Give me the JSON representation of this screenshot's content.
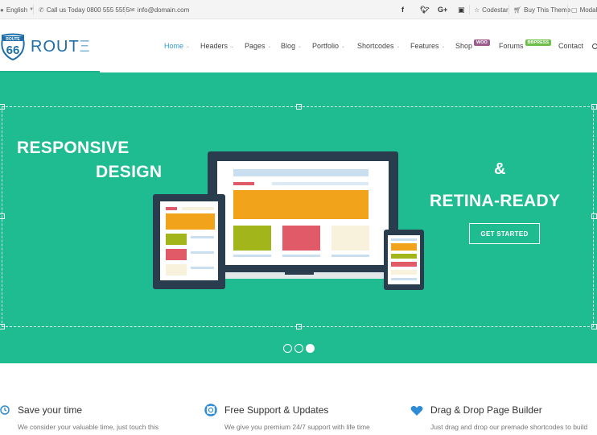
{
  "topbar": {
    "language": "English",
    "phone": "Call us Today 0800 555 5555",
    "email": "info@domain.com",
    "social": [
      "f",
      "t",
      "G+",
      "ig"
    ],
    "links": [
      "Codestar",
      "Buy This Theme",
      "Modal"
    ]
  },
  "header": {
    "logo_badge_top": "ROUTE",
    "logo_badge_num": "66",
    "logo_text": "ROUT",
    "logo_text_dim": "Ξ",
    "nav": [
      {
        "label": "Home",
        "active": true,
        "caret": true
      },
      {
        "label": "Headers",
        "caret": true
      },
      {
        "label": "Pages",
        "caret": true
      },
      {
        "label": "Blog",
        "caret": true
      },
      {
        "label": "Portfolio",
        "caret": true
      },
      {
        "label": "Shortcodes",
        "caret": true
      },
      {
        "label": "Features",
        "caret": true
      },
      {
        "label": "Shop",
        "badge": "WOO",
        "badge_color": "#9b5c8f"
      },
      {
        "label": "Forums",
        "badge": "BBPRESS",
        "badge_color": "#6fbf4b"
      },
      {
        "label": "Contact"
      }
    ]
  },
  "slider": {
    "line1": "RESPONSIVE",
    "line2": "DESIGN",
    "amp": "&",
    "line3": "RETINA-READY",
    "cta": "GET STARTED",
    "dots": 3,
    "active_dot": 3
  },
  "features": [
    {
      "icon": "clock-icon",
      "title": "Save your time",
      "text": "We consider your valuable time, just touch this"
    },
    {
      "icon": "lifebuoy-icon",
      "title": "Free Support & Updates",
      "text": "We give you premium 24/7 support with life time"
    },
    {
      "icon": "heart-icon",
      "title": "Drag & Drop Page Builder",
      "text": "Just drag and drop our premade shortcodes to build"
    }
  ],
  "colors": {
    "accent": "#1fbc92",
    "link": "#2e9bd6",
    "logo": "#1e6fa8",
    "heart": "#2e8bd6"
  }
}
